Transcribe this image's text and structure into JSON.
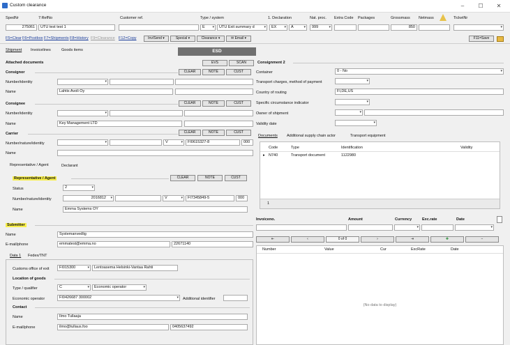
{
  "window": {
    "title": "Custom clearance",
    "minimize": "–",
    "maximize": "☐",
    "close": "✕"
  },
  "header": {
    "labels": {
      "spedno": "SpedNr",
      "refno": "7:RefNo",
      "customer_ref": "Customer ref.",
      "transport_type": "Type / system",
      "declaration": "1. Declaration",
      "nat_proc": "Nat. proc.",
      "extra_code": "Extra Code",
      "packages": "Packages",
      "gross": "Grossmass",
      "netmass": "Netmass",
      "ticket": "TicketNr"
    },
    "values": {
      "spedno": "275061",
      "refno": "UTU test test 1",
      "type": "E",
      "system": "UTU Exit summary d",
      "decl": "EX",
      "decl2": "A",
      "nat_proc": "999",
      "grossmass": "850"
    }
  },
  "toolbar": {
    "links": [
      "F5=Clear",
      "F6=Postbox",
      "F7=Shipments",
      "F8=History",
      "F9=Clearance",
      "F12=Copy"
    ],
    "menus": [
      "Inv/Send",
      "Special",
      "Clearance",
      "Email"
    ],
    "save": "F11=Save"
  },
  "tabs": [
    "Shipment",
    "Invoicelines",
    "Goods items"
  ],
  "esd_label": "ESD",
  "attached_documents": {
    "title": "Attached documents",
    "buttons": [
      "EVS",
      "SCAN"
    ]
  },
  "consignor": {
    "title": "Consignor",
    "buttons": [
      "CLEAR",
      "NOTE",
      "CUST"
    ],
    "fields": {
      "number_label": "Number/identity",
      "name_label": "Name",
      "name": "Lahtis Avoli Oy"
    }
  },
  "consignee": {
    "title": "Consignee",
    "buttons": [
      "CLEAR",
      "NOTE",
      "CUST"
    ],
    "fields": {
      "number_label": "Number/identity",
      "name_label": "Name",
      "name": "Key Management LTD"
    }
  },
  "carrier": {
    "title": "Carrier",
    "buttons": [
      "CLEAR",
      "NOTE",
      "CUST"
    ],
    "fields": {
      "number_label": "Number/nature/identity",
      "name_label": "Name",
      "flag": "V",
      "id": "FI0615327-8",
      "suffix": "000"
    }
  },
  "rep_tabs": [
    "Representative / Agent",
    "Declarant"
  ],
  "representative": {
    "title": "Representative / Agent",
    "buttons": [
      "CLEAR",
      "NOTE",
      "CUST"
    ],
    "status_label": "Status",
    "status": "2",
    "number_label": "Number/nature/identity",
    "number": "2016812",
    "flag": "V",
    "id": "FI7345849-5",
    "suffix": "000",
    "name_label": "Name",
    "name": "Emma Systems OY"
  },
  "submitter": {
    "title": "Submitter",
    "name_label": "Name",
    "name": "Systemanvedlig",
    "email_label": "E-mail/phone",
    "email": "emmatest@emma.no",
    "phone": "22671140"
  },
  "data_tabs": [
    "Data 1",
    "Fedex/TNT"
  ],
  "customs_office": {
    "label": "Customs office of exit",
    "code": "FI015300",
    "name": "Lentoasema Helsinki-Vantaa Rahti"
  },
  "location": {
    "title": "Location of goods",
    "type_label": "Type / qualifier",
    "type": "C",
    "qualifier": "Economic operator",
    "eo_label": "Economic operator",
    "eo": "FI0426687 300002",
    "additional": "Additional identifier"
  },
  "contact": {
    "title": "Contact",
    "name_label": "Name",
    "name": "Ilmo Tullaaja",
    "email_label": "E-mail/phone",
    "email": "ilmo@tullaus.foo",
    "phone": "0405637492"
  },
  "consignment2": {
    "title": "Consignment 2",
    "container_label": "Container",
    "container": "0 - No",
    "transport_label": "Transport charges, method of payment",
    "routing_label": "Country of routing",
    "routing": "FI,DE,US",
    "specific_label": "Specific circumstance indicator",
    "owner_label": "Owner of shipment",
    "validity_label": "Validity date"
  },
  "doc_tabs": [
    "Documents",
    "Additional supply chain actor",
    "Transport equipment"
  ],
  "doc_grid": {
    "headers": [
      "Code",
      "Type",
      "Identification",
      "Validity"
    ],
    "rows": [
      {
        "marker": "▸",
        "code": "N740",
        "type": "Transport document",
        "id": "1122980",
        "validity": ""
      }
    ],
    "footer_count": "1"
  },
  "invoice": {
    "headers": [
      "Invoiceno.",
      "Amount",
      "Currency",
      "Exc.rate",
      "Date"
    ],
    "nav": [
      "⇤",
      "‹",
      "0 of 0",
      "›",
      "⇥",
      "✚",
      "−"
    ],
    "grid_headers": [
      "Number",
      "Value",
      "Cur",
      "ExcRate",
      "Date"
    ],
    "empty": "(No data to display)"
  }
}
